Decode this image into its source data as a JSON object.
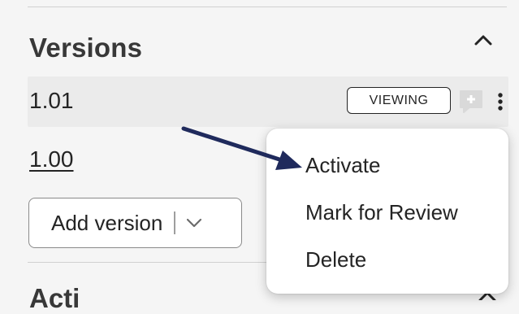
{
  "versions_panel": {
    "title": "Versions",
    "versions": [
      {
        "label": "1.01",
        "badge": "VIEWING"
      },
      {
        "label": "1.00"
      }
    ],
    "add_version_label": "Add version",
    "next_section_title": "Acti"
  },
  "context_menu": {
    "items": [
      "Activate",
      "Mark for Review",
      "Delete"
    ]
  },
  "icons": {
    "collapse": "chevron-up-icon",
    "comment": "comment-add-icon",
    "more": "more-vertical-icon",
    "dropdown": "chevron-down-icon",
    "annotation": "arrow-annotation"
  },
  "colors": {
    "annotation_arrow": "#1f2a5c",
    "active_row": "#ebebeb",
    "comment_icon": "#d9d9d9"
  }
}
